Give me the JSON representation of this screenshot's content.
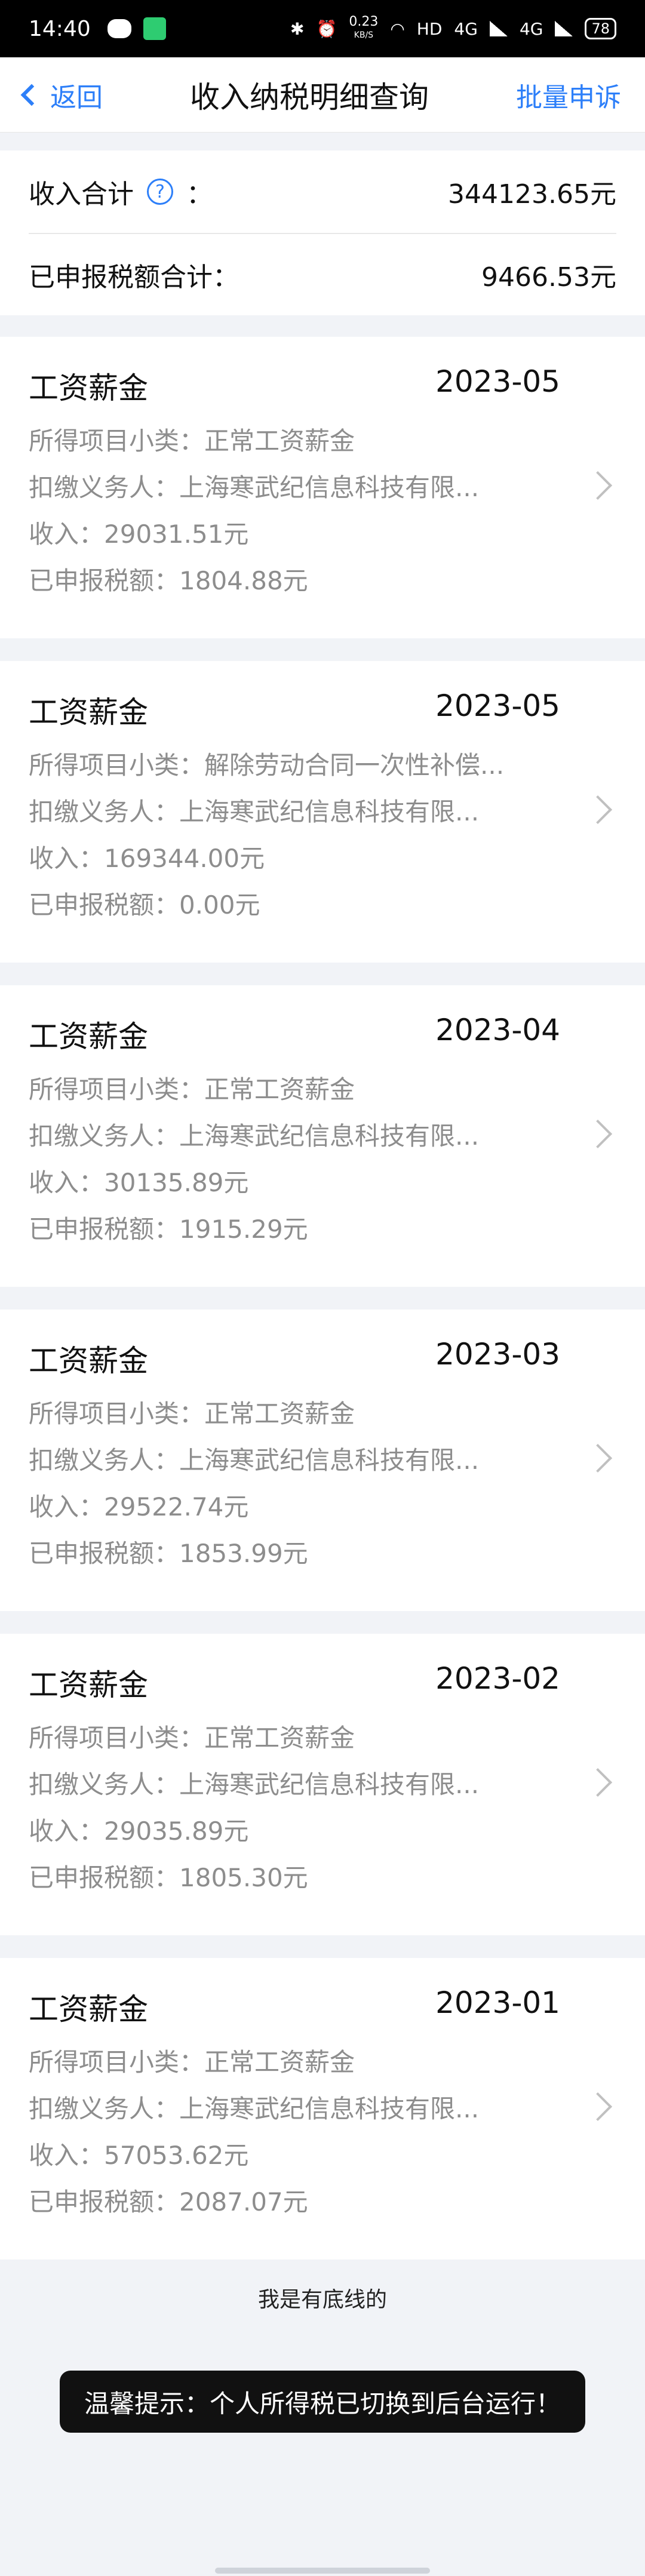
{
  "status_bar": {
    "time": "14:40",
    "net_speed_value": "0.23",
    "net_speed_unit": "KB/S",
    "hd_label": "HD",
    "signal1": "4G",
    "signal2": "4G",
    "battery": "78"
  },
  "nav": {
    "back_label": "返回",
    "title": "收入纳税明细查询",
    "action_label": "批量申诉"
  },
  "summary": {
    "income_label": "收入合计",
    "help_glyph": "?",
    "colon": "：",
    "income_value": "344123.65元",
    "tax_label": "已申报税额合计：",
    "tax_value": "9466.53元"
  },
  "records": [
    {
      "category": "工资薪金",
      "period": "2023-05",
      "subitem": "所得项目小类：正常工资薪金",
      "withholder": "扣缴义务人：上海寒武纪信息科技有限...",
      "income": "收入：29031.51元",
      "tax": "已申报税额：1804.88元"
    },
    {
      "category": "工资薪金",
      "period": "2023-05",
      "subitem": "所得项目小类：解除劳动合同一次性补偿...",
      "withholder": "扣缴义务人：上海寒武纪信息科技有限...",
      "income": "收入：169344.00元",
      "tax": "已申报税额：0.00元"
    },
    {
      "category": "工资薪金",
      "period": "2023-04",
      "subitem": "所得项目小类：正常工资薪金",
      "withholder": "扣缴义务人：上海寒武纪信息科技有限...",
      "income": "收入：30135.89元",
      "tax": "已申报税额：1915.29元"
    },
    {
      "category": "工资薪金",
      "period": "2023-03",
      "subitem": "所得项目小类：正常工资薪金",
      "withholder": "扣缴义务人：上海寒武纪信息科技有限...",
      "income": "收入：29522.74元",
      "tax": "已申报税额：1853.99元"
    },
    {
      "category": "工资薪金",
      "period": "2023-02",
      "subitem": "所得项目小类：正常工资薪金",
      "withholder": "扣缴义务人：上海寒武纪信息科技有限...",
      "income": "收入：29035.89元",
      "tax": "已申报税额：1805.30元"
    },
    {
      "category": "工资薪金",
      "period": "2023-01",
      "subitem": "所得项目小类：正常工资薪金",
      "withholder": "扣缴义务人：上海寒武纪信息科技有限...",
      "income": "收入：57053.62元",
      "tax": "已申报税额：2087.07元"
    }
  ],
  "footer_text": "我是有底线的",
  "toast": "温馨提示：个人所得税已切换到后台运行！",
  "colors": {
    "accent": "#2d7ff9",
    "secondary_text": "#8d8d8d",
    "background": "#f1f3f7"
  }
}
